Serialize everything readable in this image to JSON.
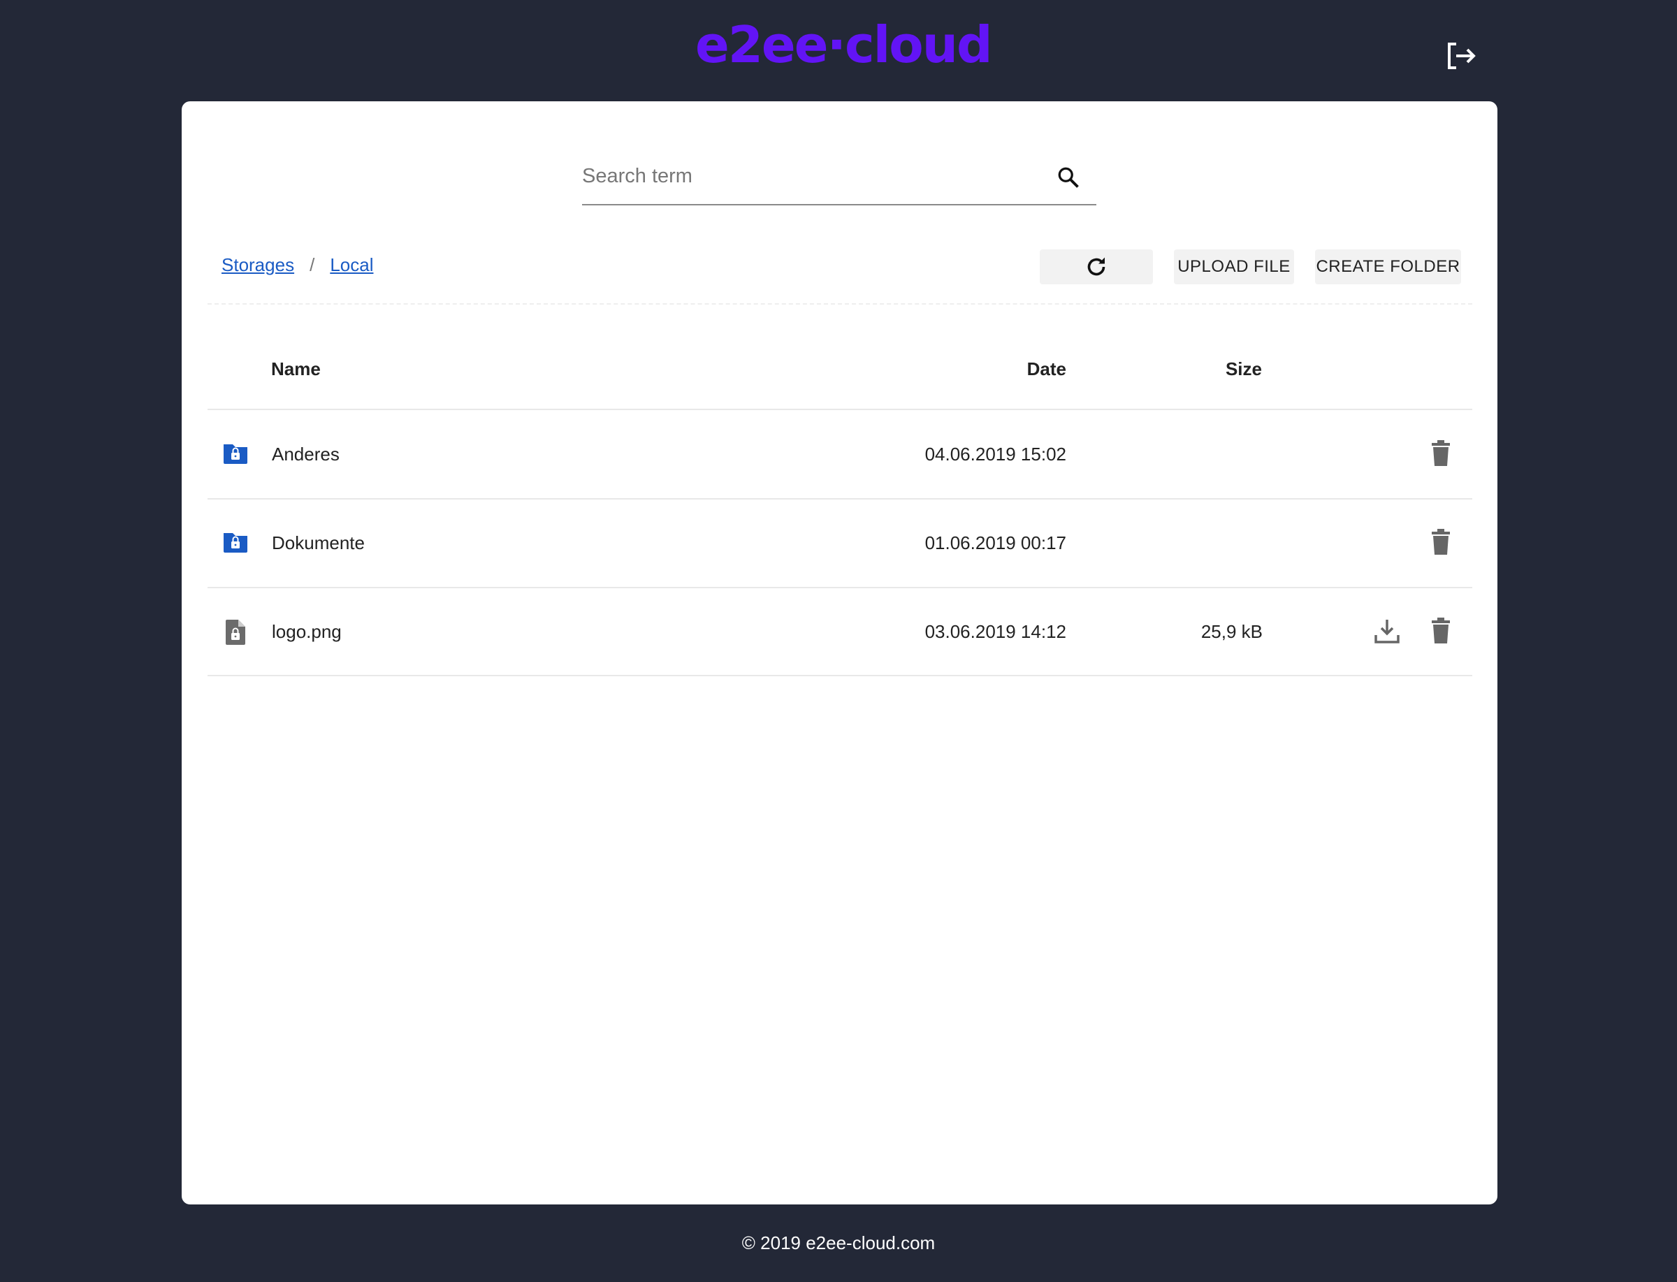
{
  "header": {
    "logo": "e2ee·cloud",
    "logout_icon": "logout-icon"
  },
  "search": {
    "placeholder": "Search term",
    "value": ""
  },
  "breadcrumb": [
    {
      "label": "Storages"
    },
    {
      "label": "Local"
    }
  ],
  "breadcrumb_separator": "/",
  "toolbar": {
    "refresh_icon": "refresh-icon",
    "upload_label": "UPLOAD FILE",
    "create_folder_label": "CREATE FOLDER"
  },
  "table": {
    "columns": {
      "name": "Name",
      "date": "Date",
      "size": "Size"
    },
    "rows": [
      {
        "type": "encrypted-folder",
        "name": "Anderes",
        "date": "04.06.2019 15:02",
        "size": ""
      },
      {
        "type": "encrypted-folder",
        "name": "Dokumente",
        "date": "01.06.2019 00:17",
        "size": ""
      },
      {
        "type": "encrypted-file",
        "name": "logo.png",
        "date": "03.06.2019 14:12",
        "size": "25,9 kB"
      }
    ]
  },
  "footer": {
    "text": "© 2019 e2ee-cloud.com"
  },
  "colors": {
    "brand": "#6214f5",
    "folder": "#1a5bc4",
    "link": "#1a5bc4",
    "background": "#232837"
  }
}
